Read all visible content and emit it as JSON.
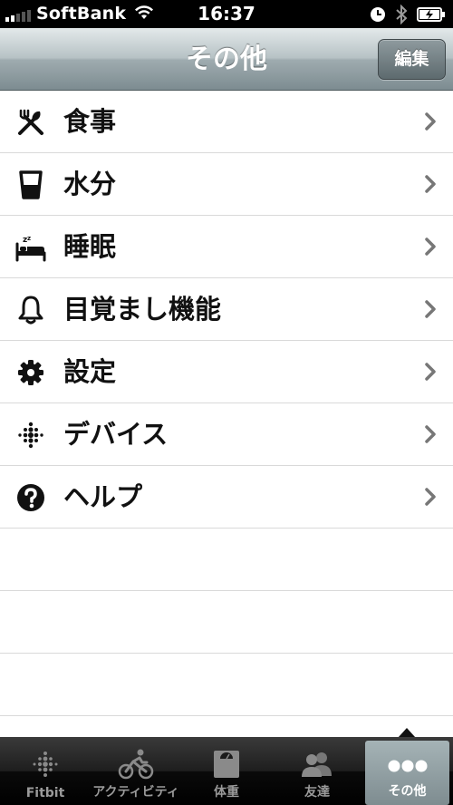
{
  "status_bar": {
    "carrier": "SoftBank",
    "time": "16:37",
    "icons": [
      "signal-icon",
      "wifi-icon",
      "alarm-clock-icon",
      "bluetooth-icon",
      "battery-charging-icon"
    ]
  },
  "nav": {
    "title": "その他",
    "edit_label": "編集"
  },
  "menu": {
    "items": [
      {
        "label": "食事",
        "icon": "fork-knife-icon"
      },
      {
        "label": "水分",
        "icon": "glass-icon"
      },
      {
        "label": "睡眠",
        "icon": "bed-icon"
      },
      {
        "label": "目覚まし機能",
        "icon": "bell-icon"
      },
      {
        "label": "設定",
        "icon": "gear-icon"
      },
      {
        "label": "デバイス",
        "icon": "device-dots-icon"
      },
      {
        "label": "ヘルプ",
        "icon": "help-icon"
      }
    ]
  },
  "tabs": [
    {
      "label": "Fitbit",
      "icon": "fitbit-logo-icon",
      "active": false
    },
    {
      "label": "アクティビティ",
      "icon": "cyclist-icon",
      "active": false
    },
    {
      "label": "体重",
      "icon": "scale-icon",
      "active": false
    },
    {
      "label": "友達",
      "icon": "friends-icon",
      "active": false
    },
    {
      "label": "その他",
      "icon": "more-dots-icon",
      "active": true
    }
  ],
  "colors": {
    "nav_bar": "#9eabaf",
    "tab_active": "#8f9da1",
    "text": "#111111"
  }
}
